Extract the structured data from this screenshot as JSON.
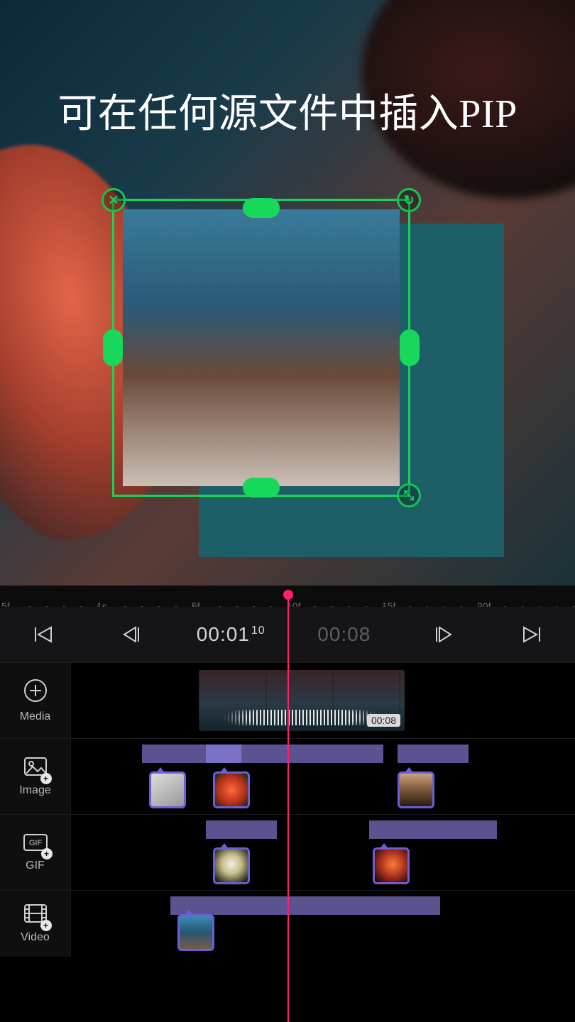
{
  "headline": "可在任何源文件中插入PIP",
  "ruler_labels": [
    "5f",
    "1s",
    "5f",
    "10f",
    "15f",
    "20f"
  ],
  "transport": {
    "current_time": "00:01",
    "current_sub": "10",
    "duration": "00:08"
  },
  "media_clip": {
    "duration_chip": "00:08"
  },
  "layers": [
    {
      "id": "media",
      "label": "Media"
    },
    {
      "id": "image",
      "label": "Image"
    },
    {
      "id": "gif",
      "label": "GIF"
    },
    {
      "id": "video",
      "label": "Video"
    }
  ],
  "icons": {
    "close": "✕",
    "rotate": "↻",
    "expand": "⤡",
    "plus": "+"
  }
}
